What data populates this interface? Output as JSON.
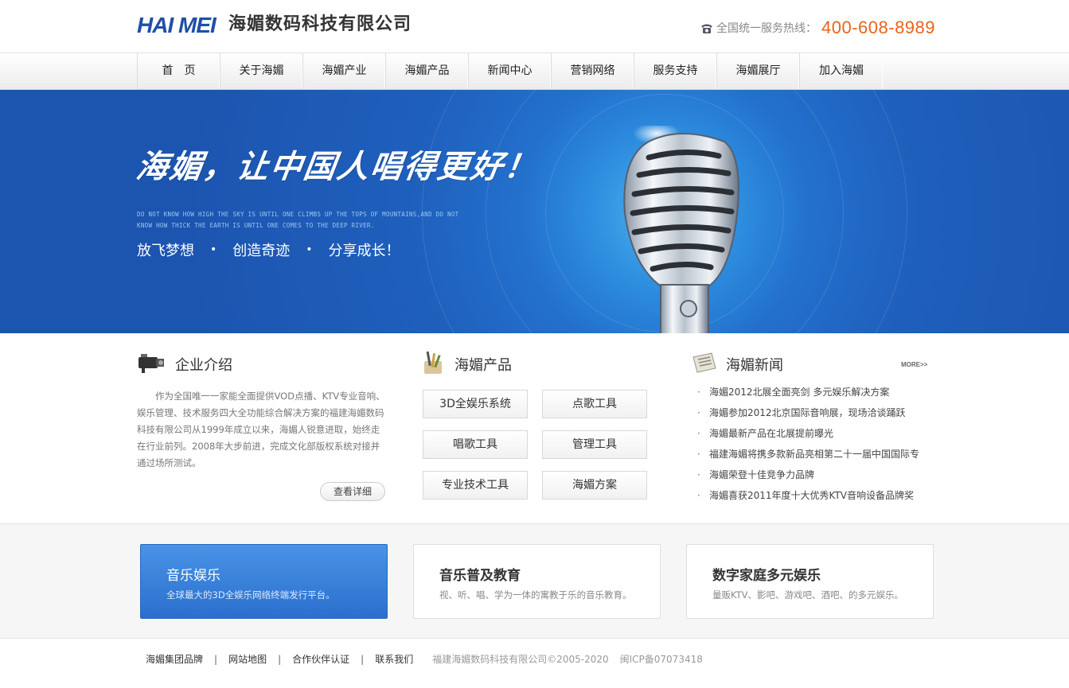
{
  "header": {
    "logo_text": "HAI MEI",
    "company_name": "海媚数码科技有限公司",
    "hotline_label": "全国统一服务热线：",
    "hotline_number": "400-608-8989"
  },
  "nav": {
    "items": [
      {
        "label": "首　页"
      },
      {
        "label": "关于海媚"
      },
      {
        "label": "海媚产业"
      },
      {
        "label": "海媚产品"
      },
      {
        "label": "新闻中心"
      },
      {
        "label": "营销网络"
      },
      {
        "label": "服务支持"
      },
      {
        "label": "海媚展厅"
      },
      {
        "label": "加入海媚"
      }
    ]
  },
  "banner": {
    "slogan": "海媚，让中国人唱得更好！",
    "tagline_en": "DO NOT KNOW HOW HIGH THE SKY IS UNTIL ONE CLIMBS UP THE TOPS OF MOUNTAINS,AND DO NOT KNOW HOW THICK THE EARTH IS UNTIL ONE COMES TO THE DEEP RIVER.",
    "motto": [
      "放飞梦想",
      "创造奇迹",
      "分享成长！"
    ],
    "motto_sep": "•"
  },
  "about": {
    "title": "企业介绍",
    "text": "作为全国唯一一家能全面提供VOD点播、KTV专业音响、娱乐管理、技术服务四大全功能综合解决方案的福建海媚数码科技有限公司从1999年成立以来，海媚人锐意进取，始终走在行业前列。2008年大步前进，完成文化部版权系统对接并通过场所测试。",
    "more": "查看详细"
  },
  "products": {
    "title": "海媚产品",
    "items": [
      {
        "label": "3D全娱乐系统"
      },
      {
        "label": "点歌工具"
      },
      {
        "label": "唱歌工具"
      },
      {
        "label": "管理工具"
      },
      {
        "label": "专业技术工具"
      },
      {
        "label": "海媚方案"
      }
    ]
  },
  "news": {
    "title": "海媚新闻",
    "more": "MORE>>",
    "bullet": "·",
    "items": [
      {
        "text": "海媚2012北展全面亮剑 多元娱乐解决方案"
      },
      {
        "text": "海媚参加2012北京国际音响展，现场洽谈踊跃"
      },
      {
        "text": "海媚最新产品在北展提前曝光"
      },
      {
        "text": "福建海媚将携多款新品亮相第二十一届中国国际专"
      },
      {
        "text": "海媚荣登十佳竞争力品牌"
      },
      {
        "text": "海媚喜获2011年度十大优秀KTV音响设备品牌奖"
      }
    ]
  },
  "features": [
    {
      "title": "音乐娱乐",
      "desc": "全球最大的3D全娱乐网络终端发行平台。"
    },
    {
      "title": "音乐普及教育",
      "desc": "视、听、唱、学为一体的寓教于乐的音乐教育。"
    },
    {
      "title": "数字家庭多元娱乐",
      "desc": "量贩KTV、影吧、游戏吧、酒吧、的多元娱乐。"
    }
  ],
  "footer": {
    "links": [
      {
        "label": "海媚集团品牌"
      },
      {
        "label": "网站地图"
      },
      {
        "label": "合作伙伴认证"
      },
      {
        "label": "联系我们"
      }
    ],
    "sep": "|",
    "copyright": "福建海媚数码科技有限公司©2005-2020",
    "icp": "闽ICP备07073418"
  },
  "colors": {
    "brand_blue": "#1f5fbc",
    "hotline_orange": "#e8641b",
    "active_feature": "#2a6fce"
  }
}
